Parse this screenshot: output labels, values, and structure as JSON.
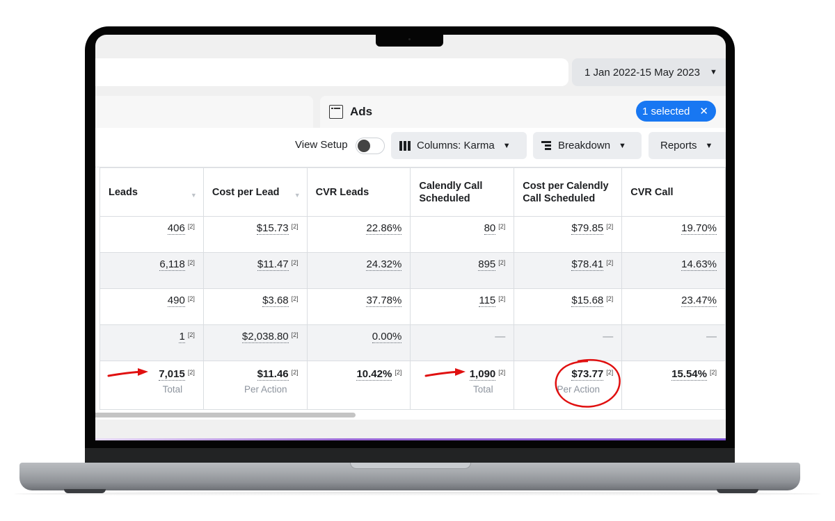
{
  "header": {
    "date_range": "1 Jan 2022-15 May 2023",
    "date_caret": "▼"
  },
  "level_tab": {
    "icon": "ads-panel-icon",
    "label": "Ads",
    "selection_label": "1 selected",
    "clear_icon": "✕"
  },
  "toolbar": {
    "view_setup_label": "View Setup",
    "view_setup_on": false,
    "columns_label": "Columns: Karma",
    "breakdown_label": "Breakdown",
    "reports_label": "Reports",
    "caret": "▼"
  },
  "table": {
    "columns": [
      {
        "label": "Leads",
        "sortable": true
      },
      {
        "label": "Cost per Lead",
        "sortable": true
      },
      {
        "label": "CVR Leads",
        "sortable": false
      },
      {
        "label": "Calendly Call Scheduled",
        "sortable": false
      },
      {
        "label": "Cost per Calendly Call Scheduled",
        "sortable": false
      },
      {
        "label": "CVR Call",
        "sortable": false
      }
    ],
    "sort_glyph": "▼",
    "footnote": "[2]",
    "dash": "—",
    "rows": [
      [
        "406",
        "$15.73",
        "22.86%",
        "80",
        "$79.85",
        "19.70%"
      ],
      [
        "6,118",
        "$11.47",
        "24.32%",
        "895",
        "$78.41",
        "14.63%"
      ],
      [
        "490",
        "$3.68",
        "37.78%",
        "115",
        "$15.68",
        "23.47%"
      ],
      [
        "1",
        "$2,038.80",
        "0.00%",
        "—",
        "—",
        "—"
      ]
    ],
    "totals": {
      "values": [
        "7,015",
        "$11.46",
        "10.42%",
        "1,090",
        "$73.77",
        "15.54%"
      ],
      "sublabels": [
        "Total",
        "Per Action",
        "",
        "Total",
        "Per Action",
        ""
      ]
    }
  },
  "annotations": {
    "color": "#e01010",
    "arrows_point_to": [
      "7,015",
      "1,090"
    ],
    "circled": "$73.77"
  }
}
